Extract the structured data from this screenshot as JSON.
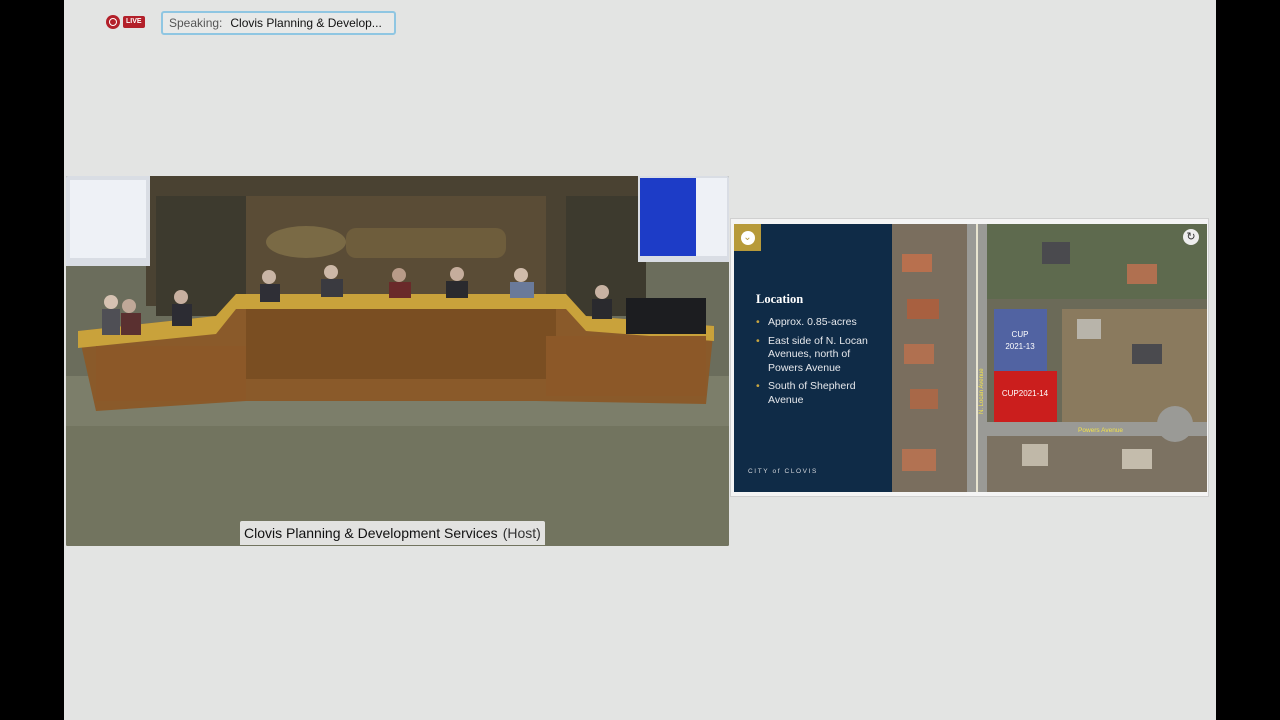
{
  "toolbar": {
    "live_badge": "LIVE",
    "speaking_label": "Speaking:",
    "speaking_name": "Clovis Planning & Develop..."
  },
  "video": {
    "participant_name": "Clovis Planning & Development Services",
    "participant_role": "(Host)"
  },
  "slide": {
    "title": "Location",
    "bullets": [
      "Approx. 0.85-acres",
      "East side of N. Locan Avenues, north of Powers Avenue",
      "South of Shepherd Avenue"
    ],
    "brand": "CITY of CLOVIS",
    "map_labels": {
      "parcel_a_line1": "CUP",
      "parcel_a_line2": "2021-13",
      "parcel_b": "CUP2021-14",
      "street_powers": "Powers Avenue",
      "street_locan": "N. Locan Avenue"
    }
  },
  "colors": {
    "background": "#e3e4e3",
    "live_red": "#b3202a",
    "speaking_border": "#8fc6e2",
    "slide_navy": "#0f2b47",
    "slide_gold": "#b79a3a",
    "parcel_blue": "#4f63a8",
    "parcel_red": "#d11a1a"
  },
  "icons": {
    "record": "record-icon",
    "collapse": "chevron-down-icon",
    "refresh": "refresh-icon"
  }
}
